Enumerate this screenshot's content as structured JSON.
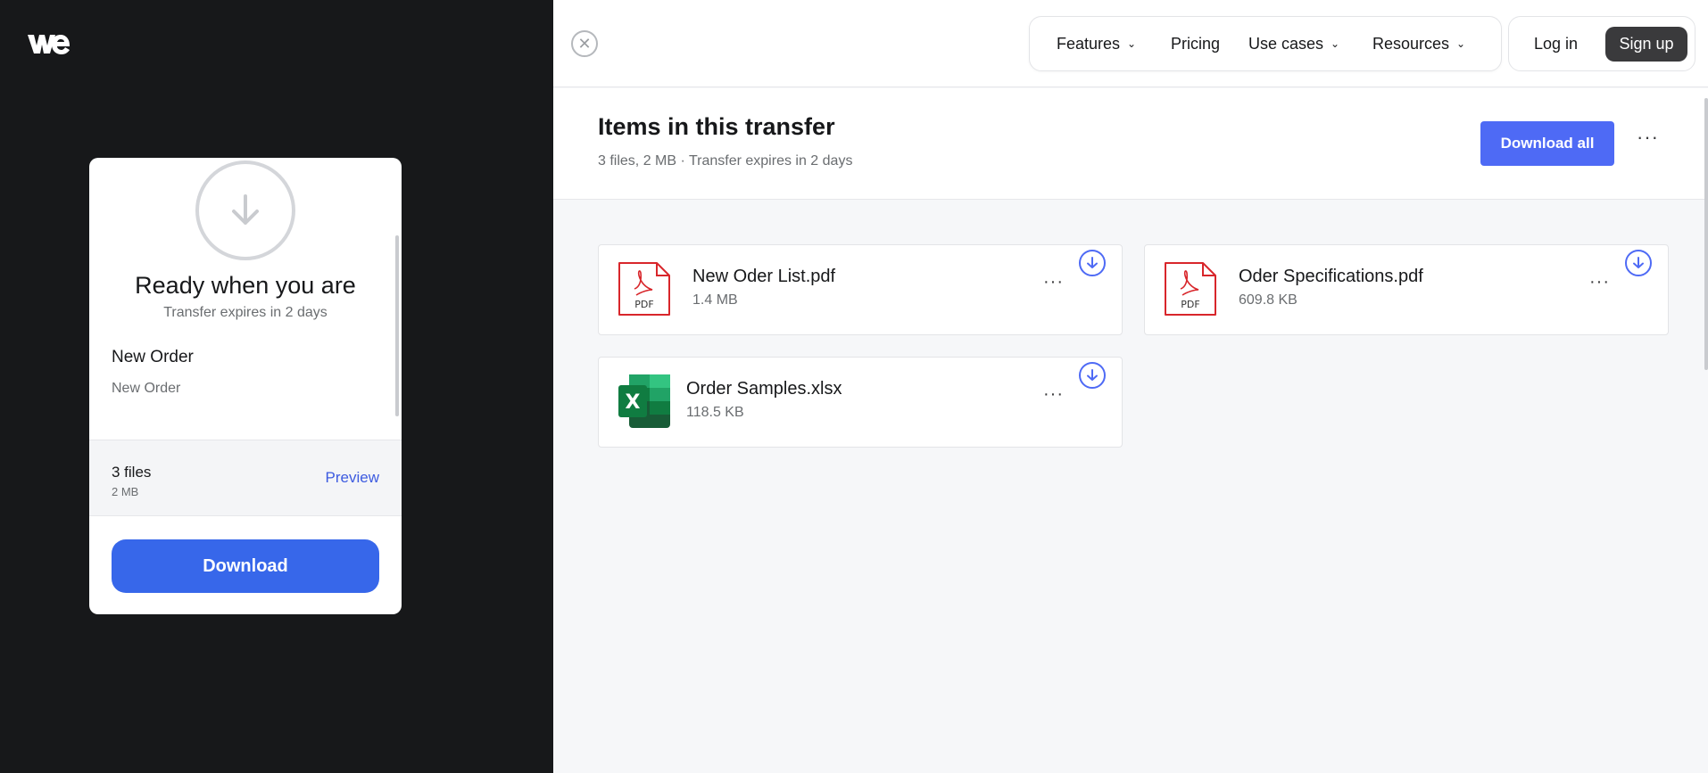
{
  "brand": {
    "logo_text": "we"
  },
  "card": {
    "title": "Ready when you are",
    "expires": "Transfer expires in 2 days",
    "transfer_name": "New Order",
    "message": "New Order",
    "files_count": "3 files",
    "files_size": "2 MB",
    "preview_label": "Preview",
    "download_label": "Download"
  },
  "nav": {
    "features": "Features",
    "pricing": "Pricing",
    "use_cases": "Use cases",
    "resources": "Resources",
    "login": "Log in",
    "signup": "Sign up"
  },
  "items": {
    "title": "Items in this transfer",
    "meta": "3 files, 2 MB · Transfer expires in 2 days",
    "download_all": "Download all"
  },
  "files": [
    {
      "name": "New Oder List.pdf",
      "size": "1.4 MB",
      "type": "pdf",
      "type_label": "PDF"
    },
    {
      "name": "Oder Specifications.pdf",
      "size": "609.8 KB",
      "type": "pdf",
      "type_label": "PDF"
    },
    {
      "name": "Order Samples.xlsx",
      "size": "118.5 KB",
      "type": "xlsx",
      "type_label": "X"
    }
  ],
  "colors": {
    "accent": "#3767ea",
    "download_all": "#4e6af5",
    "pdf_red": "#d8262b",
    "excel_green": "#1d7044",
    "dark_bg": "#17181a"
  }
}
